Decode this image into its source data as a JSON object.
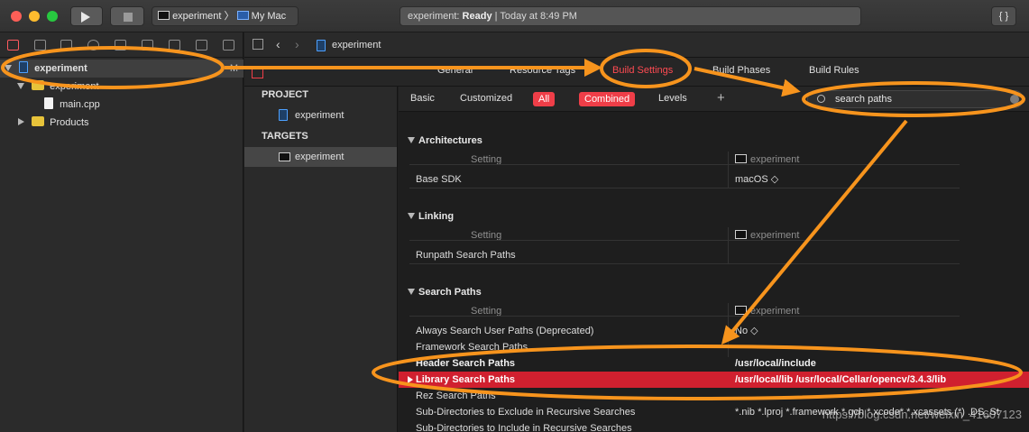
{
  "titlebar": {
    "scheme_target": "experiment",
    "scheme_sep": "〉",
    "scheme_device": "My Mac",
    "status_project": "experiment:",
    "status_state": "Ready",
    "status_sep": "|",
    "status_time": "Today at 8:49 PM",
    "braces_label": "{ }",
    "colors": {
      "close": "#fe5f57",
      "minimize": "#febc2e",
      "zoom": "#28c840"
    }
  },
  "navigator": {
    "project": "experiment",
    "project_badge": "M",
    "group": "experiment",
    "file": "main.cpp",
    "products": "Products"
  },
  "editor": {
    "breadcrumb": "experiment",
    "tabs": [
      "General",
      "Resource Tags",
      "Build Settings",
      "Build Phases",
      "Build Rules"
    ],
    "active_tab_color": "#ff4b52",
    "project_header": "PROJECT",
    "project_item": "experiment",
    "targets_header": "TARGETS",
    "target_item": "experiment"
  },
  "filter": {
    "basic": "Basic",
    "customized": "Customized",
    "all": "All",
    "combined": "Combined",
    "levels": "Levels",
    "add": "+",
    "search_value": "search paths"
  },
  "settings": {
    "architectures": {
      "title": "Architectures",
      "setting_col": "Setting",
      "target_col": "experiment",
      "rows": [
        {
          "name": "Base SDK",
          "value": "macOS ◇"
        }
      ]
    },
    "linking": {
      "title": "Linking",
      "setting_col": "Setting",
      "target_col": "experiment",
      "rows": [
        {
          "name": "Runpath Search Paths",
          "value": ""
        }
      ]
    },
    "search_paths": {
      "title": "Search Paths",
      "setting_col": "Setting",
      "target_col": "experiment",
      "rows": [
        {
          "name": "Always Search User Paths (Deprecated)",
          "value": "No ◇"
        },
        {
          "name": "Framework Search Paths",
          "value": ""
        },
        {
          "name": "Header Search Paths",
          "value": "/usr/local/include"
        },
        {
          "name": "Library Search Paths",
          "value": "/usr/local/lib /usr/local/Cellar/opencv/3.4.3/lib"
        },
        {
          "name": "Rez Search Paths",
          "value": ""
        },
        {
          "name": "Sub-Directories to Exclude in Recursive Searches",
          "value": "*.nib *.lproj *.framework *.gch *.xcode* *.xcassets (*) .DS_St"
        },
        {
          "name": "Sub-Directories to Include in Recursive Searches",
          "value": ""
        }
      ]
    }
  },
  "annotation_color": "#f7941d",
  "watermark": "https://blog.csdn.net/weixin_41607123"
}
